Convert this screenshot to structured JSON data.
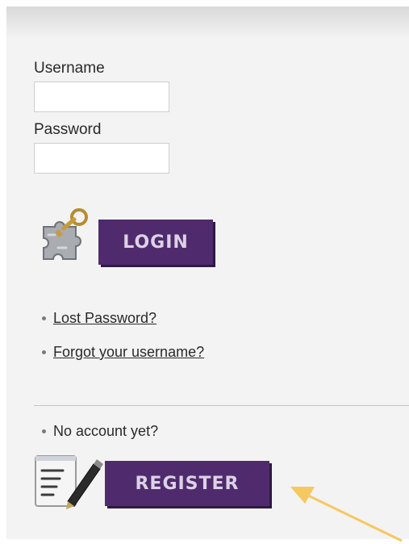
{
  "form": {
    "username_label": "Username",
    "password_label": "Password",
    "username_value": "",
    "password_value": "",
    "login_label": "LOGIN"
  },
  "links": {
    "lost_password": "Lost Password?",
    "forgot_username": "Forgot your username?"
  },
  "register": {
    "prompt": "No account yet?",
    "register_label": "REGISTER"
  },
  "colors": {
    "button_bg": "#4f2b6e",
    "button_text": "#dcd2e6",
    "arrow": "#f6c860",
    "panel_bg": "#f3f3f3"
  },
  "icons": {
    "login_icon": "key-puzzle-icon",
    "register_icon": "document-pen-icon",
    "annotation": "arrow-annotation"
  }
}
